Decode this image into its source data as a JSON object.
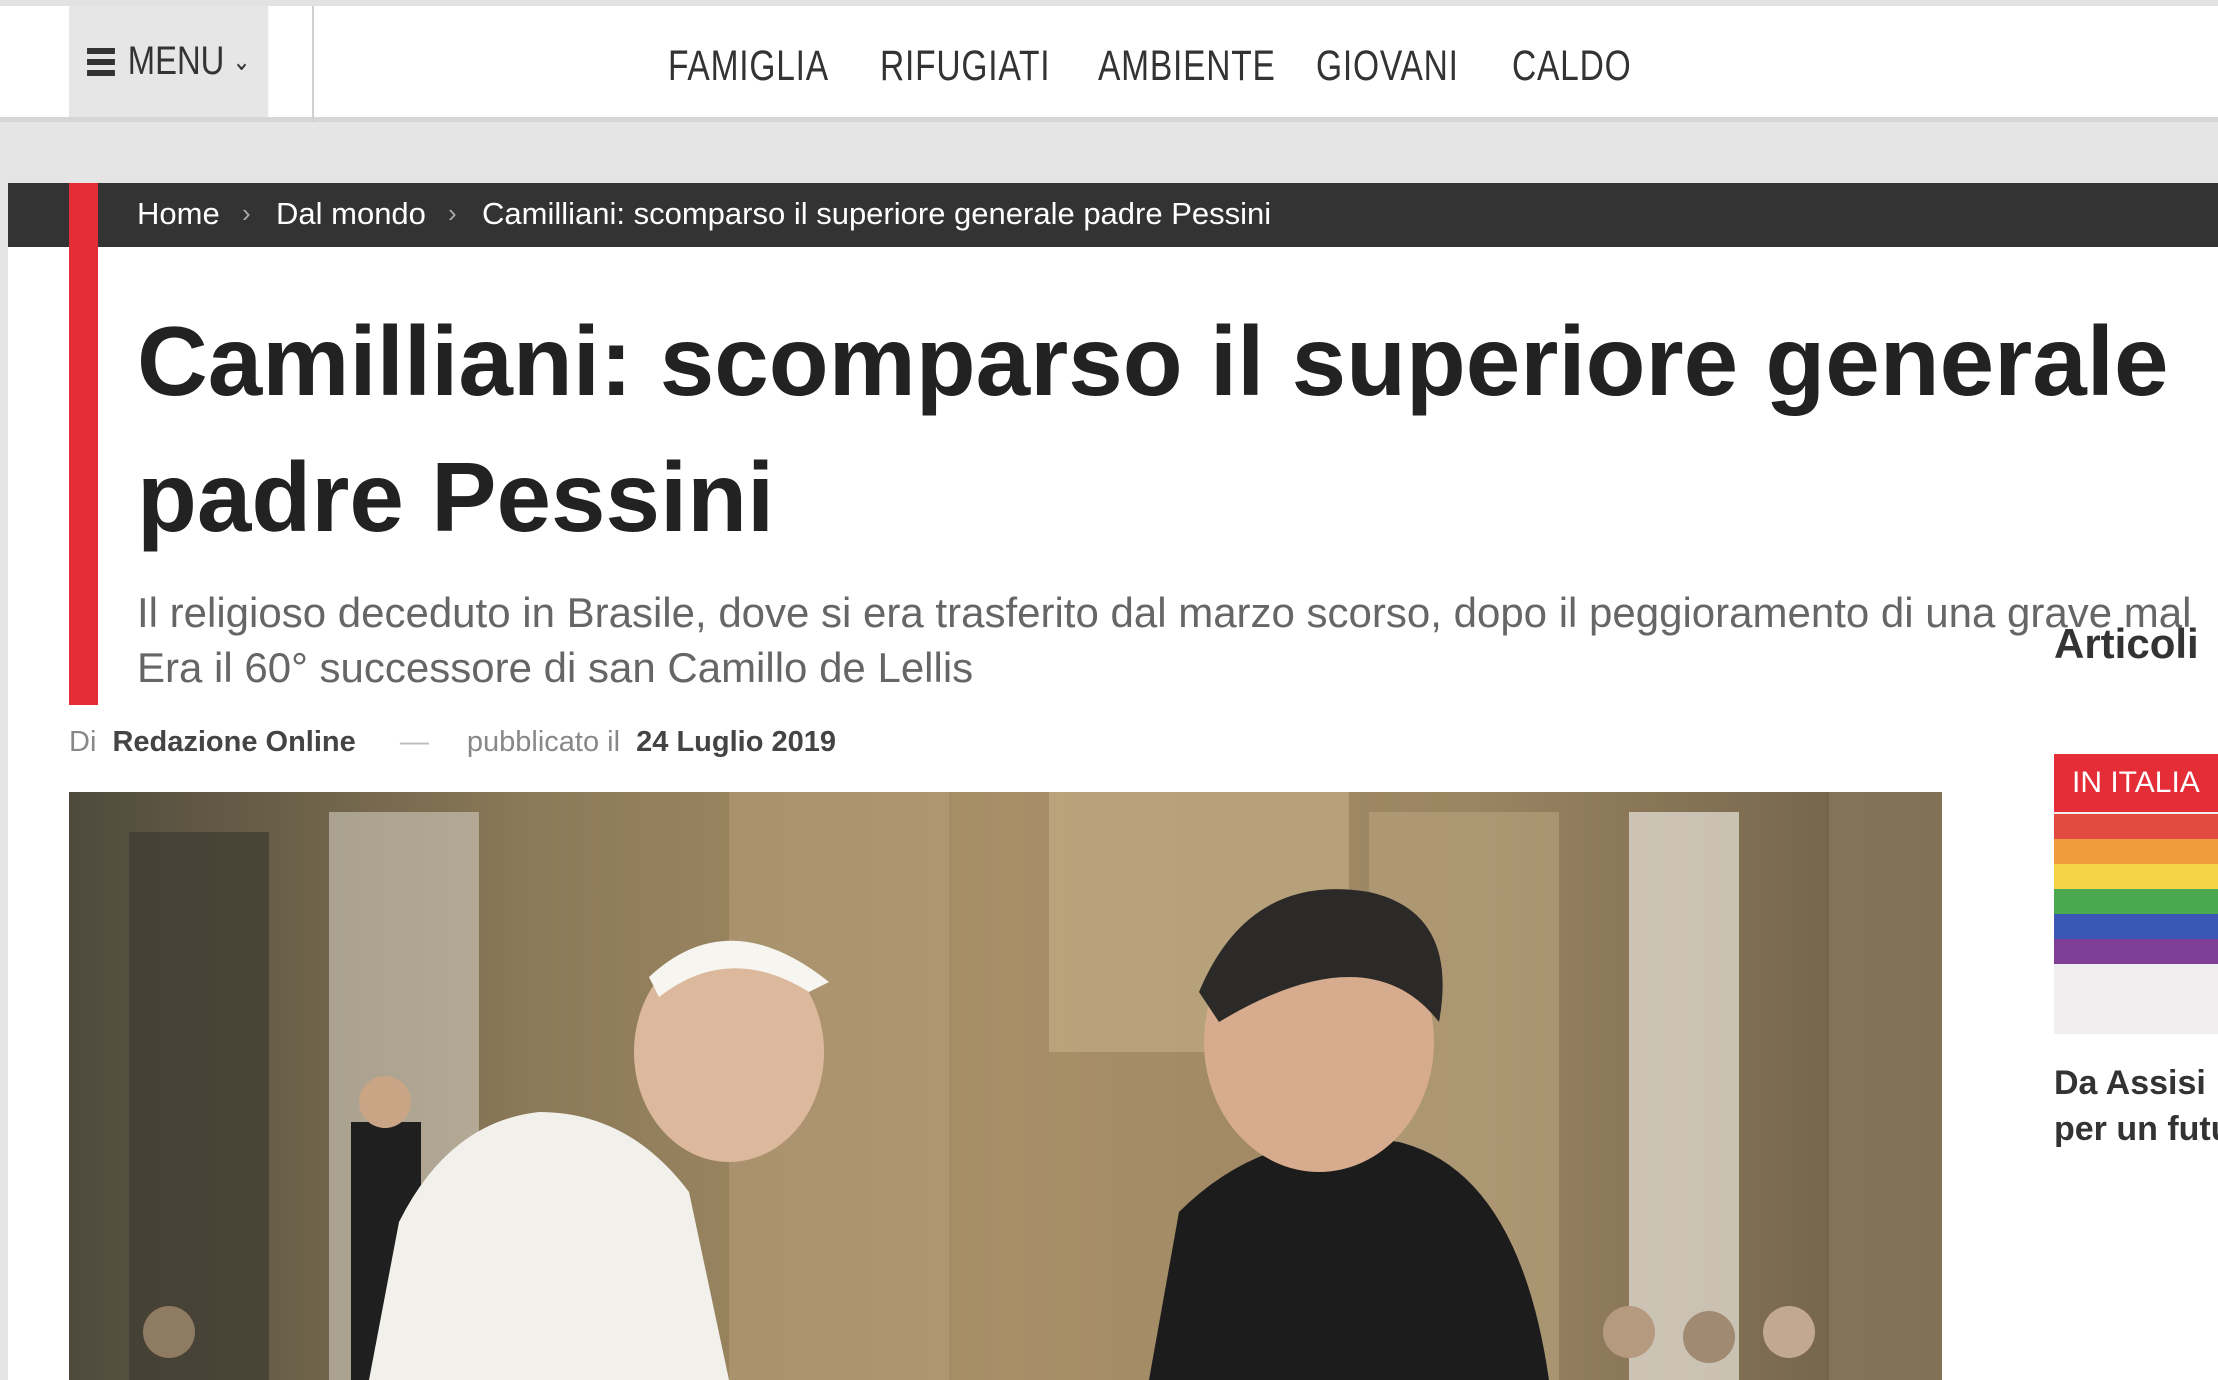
{
  "header": {
    "menu_label": "MENU",
    "nav": [
      "FAMIGLIA",
      "RIFUGIATI",
      "AMBIENTE",
      "GIOVANI",
      "CALDO"
    ]
  },
  "breadcrumb": {
    "home": "Home",
    "section": "Dal mondo",
    "current": "Camilliani: scomparso il superiore generale padre Pessini"
  },
  "article": {
    "title_line1": "Camilliani: scomparso il superiore generale",
    "title_line2": "padre Pessini",
    "subtitle_line1": "Il religioso deceduto in Brasile, dove si era trasferito dal marzo scorso, dopo il peggioramento di una grave mal",
    "subtitle_line2": "Era il 60° successore di san Camillo de Lellis",
    "by_prefix": "Di",
    "author": "Redazione Online",
    "dash": "—",
    "published_prefix": "pubblicato il",
    "date": "24 Luglio 2019"
  },
  "sidebar": {
    "title": "Articoli",
    "card_badge": "IN ITALIA",
    "card_title_line1": "Da Assisi",
    "card_title_line2": "per un futu"
  },
  "colors": {
    "accent": "#e42d36",
    "dark_bar": "#333333"
  }
}
